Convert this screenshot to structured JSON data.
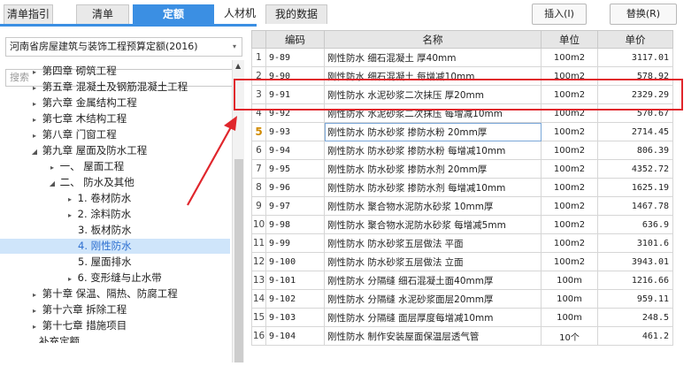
{
  "tabs": [
    {
      "label": "清单指引"
    },
    {
      "label": "清单"
    },
    {
      "label": "定额"
    },
    {
      "label": "人材机"
    },
    {
      "label": "我的数据"
    }
  ],
  "toolbar": {
    "insert_label": "插入(I)",
    "replace_label": "替换(R)"
  },
  "left": {
    "quota_selector": "河南省房屋建筑与装饰工程预算定额(2016)",
    "search_placeholder": "搜索"
  },
  "tree": [
    {
      "label": "第四章 砌筑工程",
      "toggle": "▸"
    },
    {
      "label": "第五章 混凝土及钢筋混凝土工程",
      "toggle": "▸"
    },
    {
      "label": "第六章 金属结构工程",
      "toggle": "▸"
    },
    {
      "label": "第七章 木结构工程",
      "toggle": "▸"
    },
    {
      "label": "第八章 门窗工程",
      "toggle": "▸"
    },
    {
      "label": "第九章 屋面及防水工程",
      "toggle": "◢"
    },
    {
      "label": "一、 屋面工程",
      "toggle": "▸"
    },
    {
      "label": "二、 防水及其他",
      "toggle": "◢"
    },
    {
      "label": "1. 卷材防水",
      "toggle": "▸"
    },
    {
      "label": "2. 涂料防水",
      "toggle": "▸"
    },
    {
      "label": "3. 板材防水",
      "toggle": ""
    },
    {
      "label": "4. 刚性防水",
      "toggle": "",
      "selected": true
    },
    {
      "label": "5. 屋面排水",
      "toggle": ""
    },
    {
      "label": "6. 变形缝与止水带",
      "toggle": "▸"
    },
    {
      "label": "第十章 保温、隔热、防腐工程",
      "toggle": "▸"
    },
    {
      "label": "第十六章 拆除工程",
      "toggle": "▸"
    },
    {
      "label": "第十七章 措施项目",
      "toggle": "▸"
    },
    {
      "label": "补充定额",
      "toggle": ""
    }
  ],
  "table": {
    "headers": {
      "code": "编码",
      "name": "名称",
      "unit": "单位",
      "price": "单价"
    },
    "rows": [
      {
        "n": "1",
        "code": "9-89",
        "name": "刚性防水 细石混凝土 厚40mm",
        "unit": "100m2",
        "price": "3117.01"
      },
      {
        "n": "2",
        "code": "9-90",
        "name": "刚性防水 细石混凝土 每增减10mm",
        "unit": "100m2",
        "price": "578.92"
      },
      {
        "n": "3",
        "code": "9-91",
        "name": "刚性防水 水泥砂浆二次抹压 厚20mm",
        "unit": "100m2",
        "price": "2329.29"
      },
      {
        "n": "4",
        "code": "9-92",
        "name": "刚性防水 水泥砂浆二次抹压 每增减10mm",
        "unit": "100m2",
        "price": "570.67"
      },
      {
        "n": "5",
        "code": "9-93",
        "name": "刚性防水 防水砂浆 掺防水粉 20mm厚",
        "unit": "100m2",
        "price": "2714.45"
      },
      {
        "n": "6",
        "code": "9-94",
        "name": "刚性防水 防水砂浆 掺防水粉 每增减10mm",
        "unit": "100m2",
        "price": "806.39"
      },
      {
        "n": "7",
        "code": "9-95",
        "name": "刚性防水 防水砂浆 掺防水剂 20mm厚",
        "unit": "100m2",
        "price": "4352.72"
      },
      {
        "n": "8",
        "code": "9-96",
        "name": "刚性防水 防水砂浆 掺防水剂 每增减10mm",
        "unit": "100m2",
        "price": "1625.19"
      },
      {
        "n": "9",
        "code": "9-97",
        "name": "刚性防水 聚合物水泥防水砂浆 10mm厚",
        "unit": "100m2",
        "price": "1467.78"
      },
      {
        "n": "10",
        "code": "9-98",
        "name": "刚性防水 聚合物水泥防水砂浆 每增减5mm",
        "unit": "100m2",
        "price": "636.9"
      },
      {
        "n": "11",
        "code": "9-99",
        "name": "刚性防水 防水砂浆五层做法 平面",
        "unit": "100m2",
        "price": "3101.6"
      },
      {
        "n": "12",
        "code": "9-100",
        "name": "刚性防水 防水砂浆五层做法 立面",
        "unit": "100m2",
        "price": "3943.01"
      },
      {
        "n": "13",
        "code": "9-101",
        "name": "刚性防水 分隔缝 细石混凝土面40mm厚",
        "unit": "100m",
        "price": "1216.66"
      },
      {
        "n": "14",
        "code": "9-102",
        "name": "刚性防水 分隔缝 水泥砂浆面层20mm厚",
        "unit": "100m",
        "price": "959.11"
      },
      {
        "n": "15",
        "code": "9-103",
        "name": "刚性防水 分隔缝 面层厚度每增减10mm",
        "unit": "100m",
        "price": "248.5"
      },
      {
        "n": "16",
        "code": "9-104",
        "name": "刚性防水 制作安装屋面保温层透气管",
        "unit": "10个",
        "price": "461.2"
      }
    ]
  },
  "colors": {
    "accent": "#3b8fe3",
    "annotation": "#e0262c"
  }
}
